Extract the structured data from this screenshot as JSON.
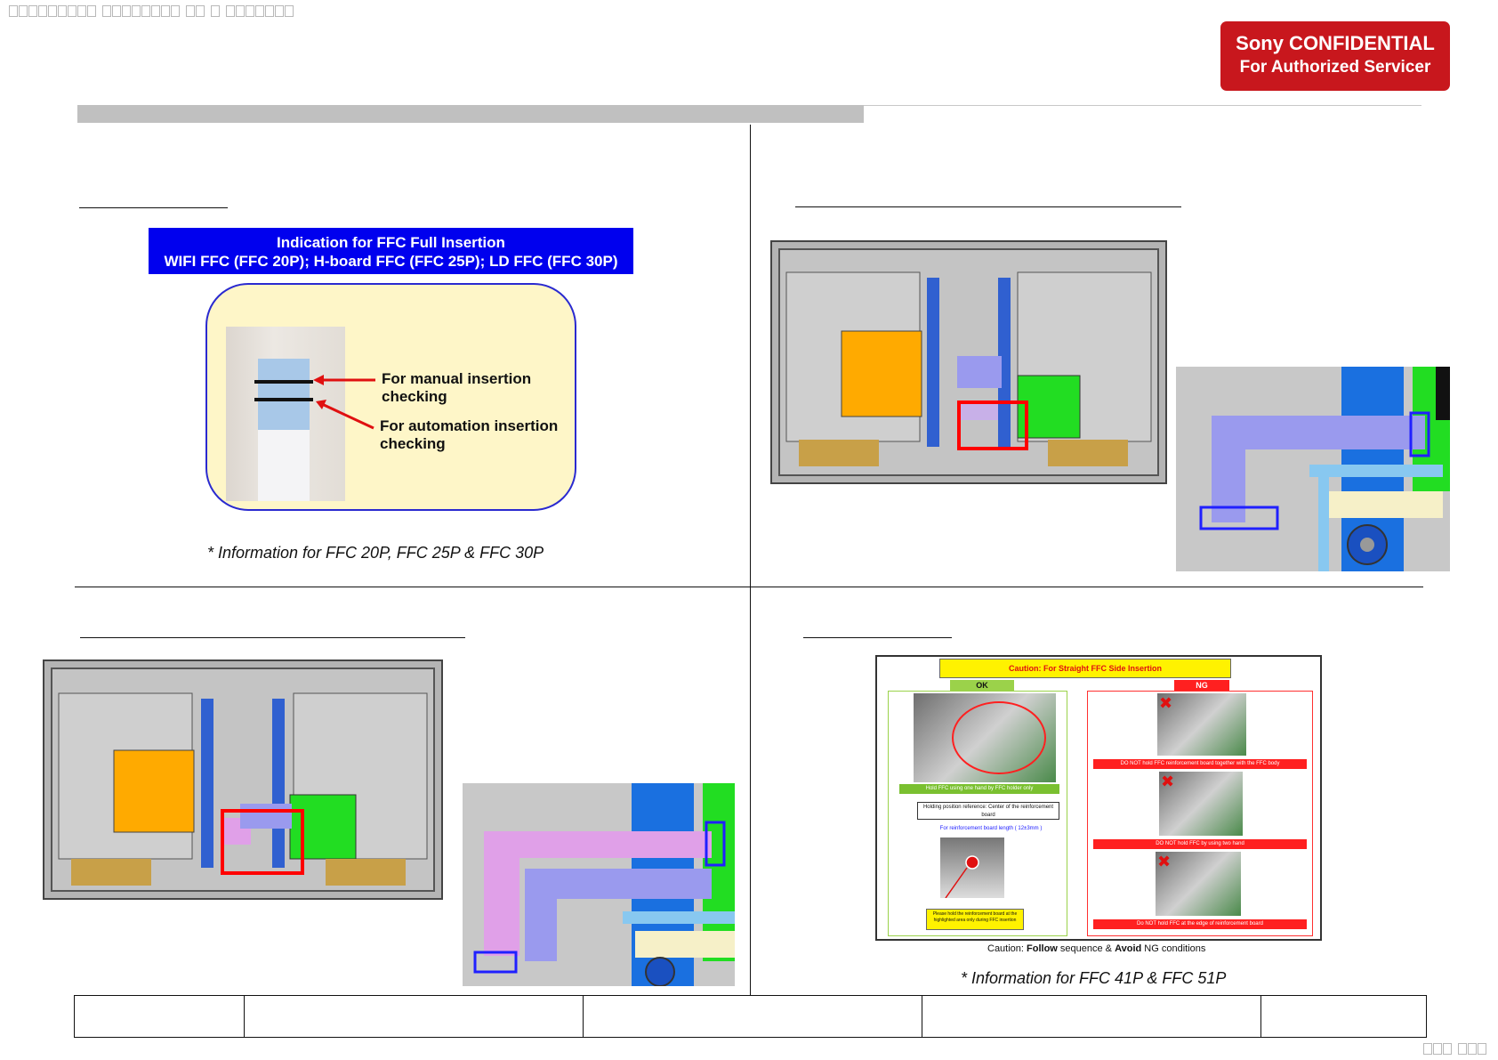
{
  "badge": {
    "line1": "Sony CONFIDENTIAL",
    "line2": "For Authorized Servicer"
  },
  "info_panel": {
    "title_line1": "Indication for FFC Full Insertion",
    "title_line2": "WIFI FFC (FFC 20P); H-board FFC (FFC 25P); LD FFC (FFC 30P)",
    "callout_manual": "For manual insertion checking",
    "callout_auto": "For automation insertion checking",
    "note": "* Information for FFC 20P, FFC 25P & FFC 30P"
  },
  "caution_panel": {
    "title": "Caution: For Straight FFC Side Insertion",
    "ok_label": "OK",
    "ng_label": "NG",
    "ok_caption": "Hold FFC using one hand by FFC holder only",
    "holding_ref": "Holding position reference: Center of the reinforcement board",
    "board_length": "For reinforcement board length ( 12±3mm )",
    "yellow_note": "Please hold the reinforcement board at the highlighted area only during FFC insertion",
    "ng_caption_1": "DO NOT hold FFC reinforcement board together with the FFC body",
    "ng_caption_2": "DO NOT hold FFC by using two hand",
    "ng_caption_3": "Do NOT hold FFC at the edge of reinforcement board",
    "footer_prefix": "Caution: ",
    "footer_follow": "Follow",
    "footer_mid": " sequence & ",
    "footer_avoid": "Avoid",
    "footer_suffix": " NG conditions",
    "note": "* Information for FFC 41P & FFC 51P"
  },
  "colors": {
    "badge_red": "#c8171d",
    "title_blue": "#0000ee",
    "highlight_red": "#ff0000",
    "highlight_blue": "#2020ff",
    "pcb_green": "#22dd22",
    "board_orange": "#ffaa00"
  }
}
